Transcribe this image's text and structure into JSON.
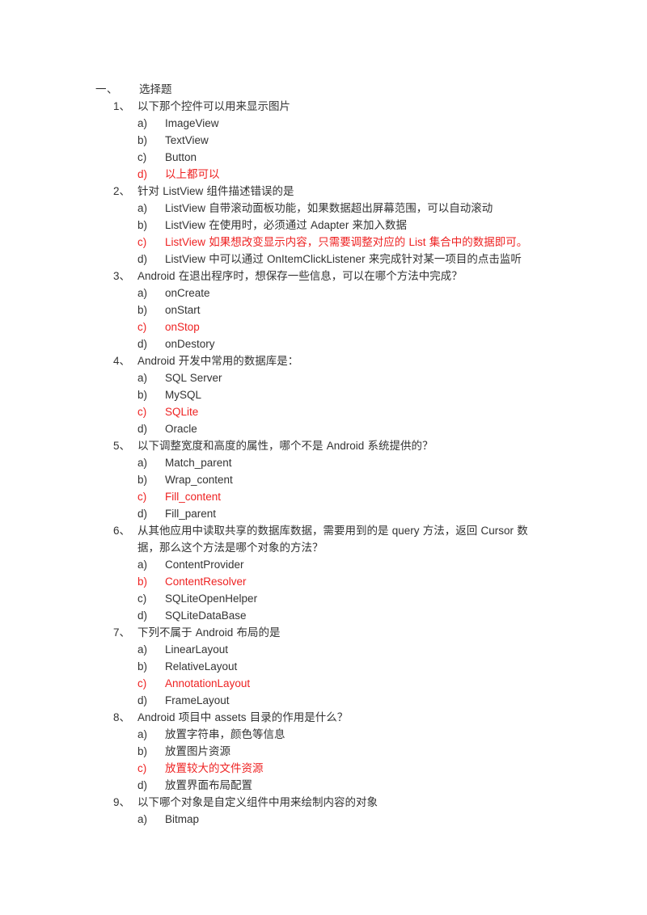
{
  "document": {
    "section": {
      "number": "一、",
      "title": "选择题"
    },
    "answer_color": "#ee2222",
    "text_color": "#333333",
    "questions": [
      {
        "number": "1、",
        "text": "以下那个控件可以用来显示图片",
        "options": [
          {
            "letter": "a)",
            "text": "ImageView",
            "is_answer": false
          },
          {
            "letter": "b)",
            "text": "TextView",
            "is_answer": false
          },
          {
            "letter": "c)",
            "text": "Button",
            "is_answer": false
          },
          {
            "letter": "d)",
            "text": "以上都可以",
            "is_answer": true
          }
        ]
      },
      {
        "number": "2、",
        "text": "针对 ListView 组件描述错误的是",
        "options": [
          {
            "letter": "a)",
            "text": "ListView 自带滚动面板功能，如果数据超出屏幕范围，可以自动滚动",
            "is_answer": false
          },
          {
            "letter": "b)",
            "text": "ListView 在使用时，必须通过 Adapter 来加入数据",
            "is_answer": false
          },
          {
            "letter": "c)",
            "text": "ListView 如果想改变显示内容，只需要调整对应的 List 集合中的数据即可。",
            "is_answer": true
          },
          {
            "letter": "d)",
            "text": "ListView 中可以通过 OnItemClickListener 来完成针对某一项目的点击监听",
            "is_answer": false
          }
        ]
      },
      {
        "number": "3、",
        "text": "Android 在退出程序时，想保存一些信息，可以在哪个方法中完成？",
        "options": [
          {
            "letter": "a)",
            "text": "onCreate",
            "is_answer": false
          },
          {
            "letter": "b)",
            "text": "onStart",
            "is_answer": false
          },
          {
            "letter": "c)",
            "text": "onStop",
            "is_answer": true
          },
          {
            "letter": "d)",
            "text": "onDestory",
            "is_answer": false
          }
        ]
      },
      {
        "number": "4、",
        "text": "Android 开发中常用的数据库是：",
        "options": [
          {
            "letter": "a)",
            "text": "SQL Server",
            "is_answer": false
          },
          {
            "letter": "b)",
            "text": "MySQL",
            "is_answer": false
          },
          {
            "letter": "c)",
            "text": "SQLite",
            "is_answer": true
          },
          {
            "letter": "d)",
            "text": "Oracle",
            "is_answer": false
          }
        ]
      },
      {
        "number": "5、",
        "text": "以下调整宽度和高度的属性，哪个不是 Android 系统提供的？",
        "options": [
          {
            "letter": "a)",
            "text": "Match_parent",
            "is_answer": false
          },
          {
            "letter": "b)",
            "text": "Wrap_content",
            "is_answer": false
          },
          {
            "letter": "c)",
            "text": "Fill_content",
            "is_answer": true
          },
          {
            "letter": "d)",
            "text": "Fill_parent",
            "is_answer": false
          }
        ]
      },
      {
        "number": "6、",
        "text": "从其他应用中读取共享的数据库数据，需要用到的是 query 方法，返回 Cursor 数据，那么这个方法是哪个对象的方法？",
        "options": [
          {
            "letter": "a)",
            "text": "ContentProvider",
            "is_answer": false
          },
          {
            "letter": "b)",
            "text": "ContentResolver",
            "is_answer": true
          },
          {
            "letter": "c)",
            "text": "SQLiteOpenHelper",
            "is_answer": false
          },
          {
            "letter": "d)",
            "text": "SQLiteDataBase",
            "is_answer": false
          }
        ]
      },
      {
        "number": "7、",
        "text": "下列不属于 Android 布局的是",
        "options": [
          {
            "letter": "a)",
            "text": "LinearLayout",
            "is_answer": false
          },
          {
            "letter": "b)",
            "text": "RelativeLayout",
            "is_answer": false
          },
          {
            "letter": "c)",
            "text": "AnnotationLayout",
            "is_answer": true
          },
          {
            "letter": "d)",
            "text": "FrameLayout",
            "is_answer": false
          }
        ]
      },
      {
        "number": "8、",
        "text": "Android 项目中 assets 目录的作用是什么？",
        "options": [
          {
            "letter": "a)",
            "text": "放置字符串，颜色等信息",
            "is_answer": false
          },
          {
            "letter": "b)",
            "text": "放置图片资源",
            "is_answer": false
          },
          {
            "letter": "c)",
            "text": "放置较大的文件资源",
            "is_answer": true
          },
          {
            "letter": "d)",
            "text": "放置界面布局配置",
            "is_answer": false
          }
        ]
      },
      {
        "number": "9、",
        "text": "以下哪个对象是自定义组件中用来绘制内容的对象",
        "options": [
          {
            "letter": "a)",
            "text": "Bitmap",
            "is_answer": false
          }
        ]
      }
    ]
  }
}
